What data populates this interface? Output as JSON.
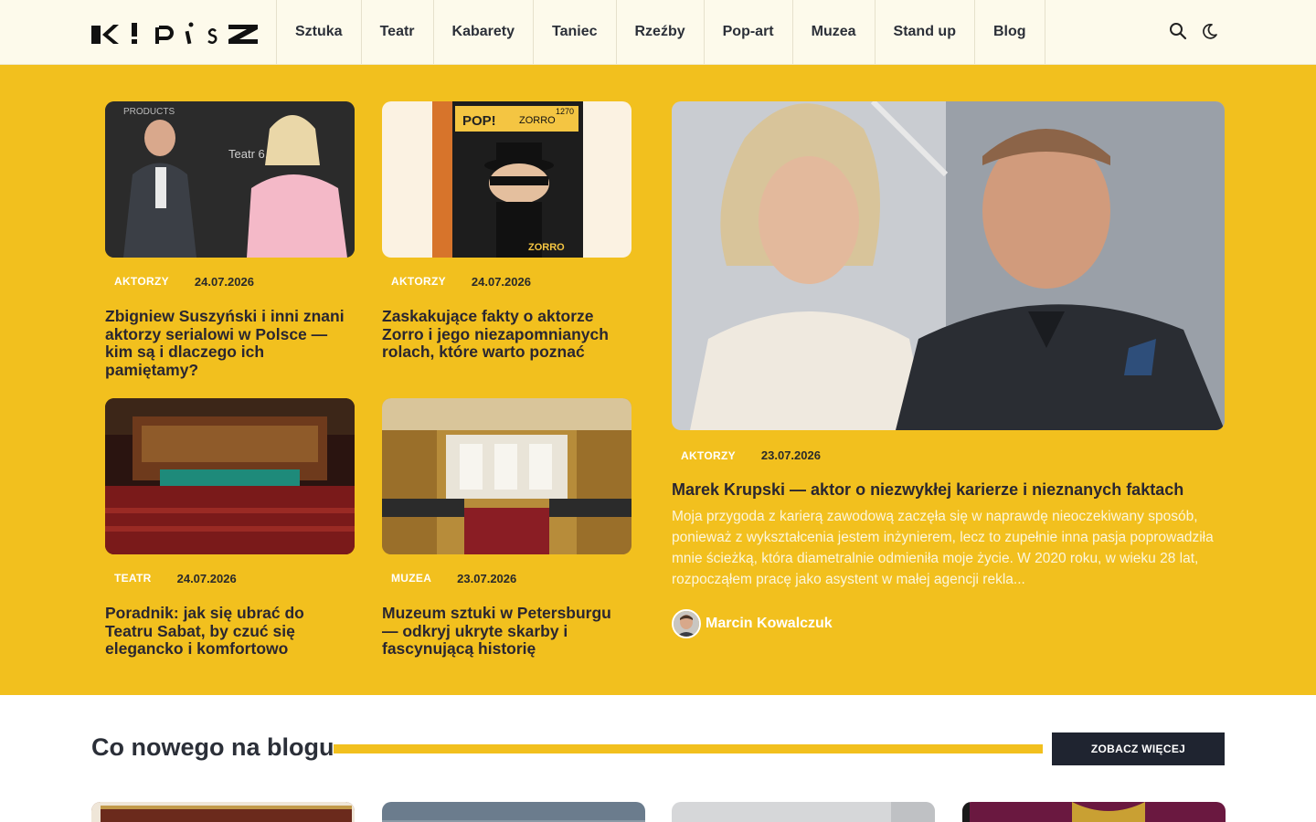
{
  "brand": {
    "logo_text": "K!PiSZ",
    "accent": "#f2c01e",
    "dark": "#1f2430"
  },
  "nav": {
    "items": [
      {
        "label": "Sztuka"
      },
      {
        "label": "Teatr"
      },
      {
        "label": "Kabarety"
      },
      {
        "label": "Taniec"
      },
      {
        "label": "Rzeźby"
      },
      {
        "label": "Pop-art"
      },
      {
        "label": "Muzea"
      },
      {
        "label": "Stand up"
      },
      {
        "label": "Blog"
      }
    ],
    "icons": [
      "search-icon",
      "moon-icon"
    ]
  },
  "articles": [
    {
      "category": "AKTORZY",
      "date": "24.07.2026",
      "title": "Zbigniew Suszyński i inni znani aktorzy serialowi w Polsce — kim są i dlaczego ich pamiętamy?"
    },
    {
      "category": "AKTORZY",
      "date": "24.07.2026",
      "title": "Zaskakujące fakty o aktorze Zorro i jego niezapomnianych rolach, które warto poznać"
    },
    {
      "category": "TEATR",
      "date": "24.07.2026",
      "title": "Poradnik: jak się ubrać do Teatru Sabat, by czuć się elegancko i komfortowo"
    },
    {
      "category": "MUZEA",
      "date": "23.07.2026",
      "title": "Muzeum sztuki w Petersburgu — odkryj ukryte skarby i fascynującą historię"
    }
  ],
  "featured": {
    "category": "AKTORZY",
    "date": "23.07.2026",
    "title": "Marek Krupski — aktor o niezwykłej karierze i nieznanych faktach",
    "excerpt": "Moja przygoda z karierą zawodową zaczęła się w naprawdę nieoczekiwany sposób, ponieważ z wykształcenia jestem inżynierem, lecz to zupełnie inna pasja poprowadziła mnie ścieżką, która diametralnie odmieniła moje życie. W 2020 roku, w wieku 28 lat, rozpocząłem pracę jako asystent w małej agencji rekla...",
    "author": "Marcin Kowalczuk"
  },
  "blog": {
    "heading": "Co nowego na blogu",
    "more_label": "ZOBACZ WIĘCEJ"
  }
}
